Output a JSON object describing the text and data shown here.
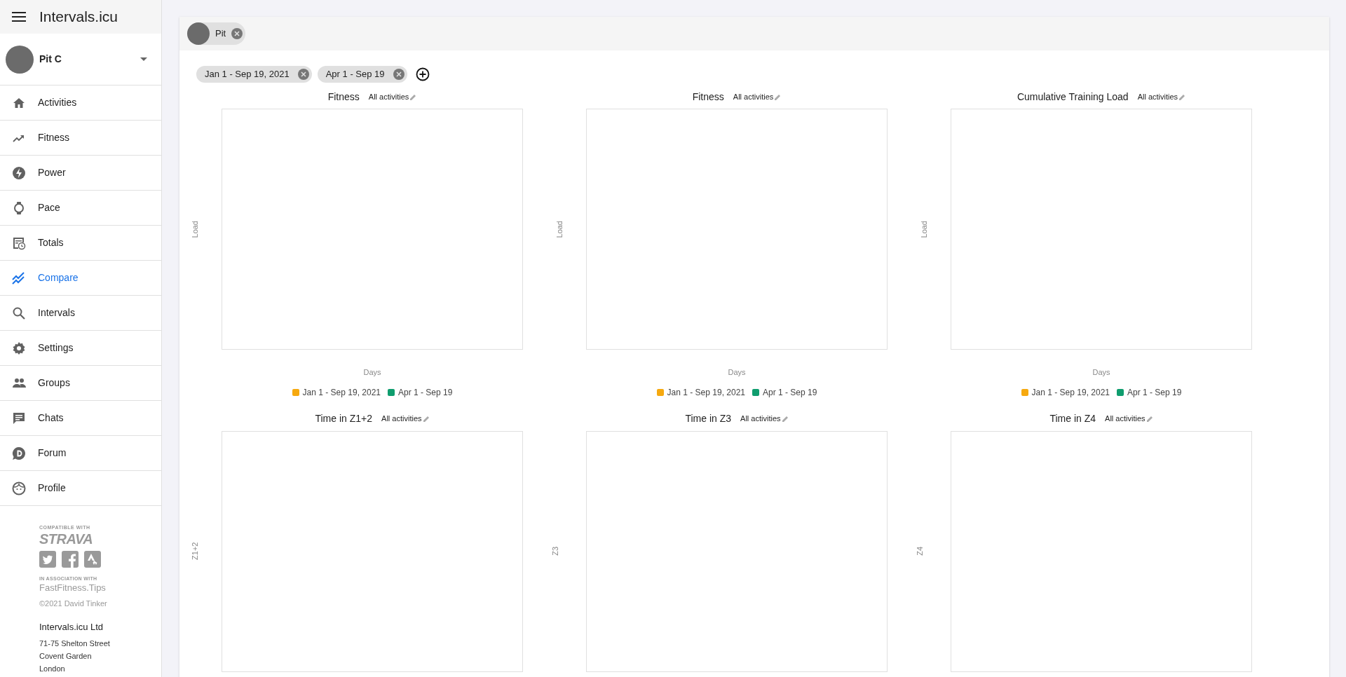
{
  "app": {
    "title": "Intervals.icu"
  },
  "user": {
    "name": "Pit C"
  },
  "nav": [
    {
      "label": "Activities",
      "selected": false
    },
    {
      "label": "Fitness",
      "selected": false
    },
    {
      "label": "Power",
      "selected": false
    },
    {
      "label": "Pace",
      "selected": false
    },
    {
      "label": "Totals",
      "selected": false
    },
    {
      "label": "Compare",
      "selected": true
    },
    {
      "label": "Intervals",
      "selected": false
    },
    {
      "label": "Settings",
      "selected": false
    },
    {
      "label": "Groups",
      "selected": false
    },
    {
      "label": "Chats",
      "selected": false
    },
    {
      "label": "Forum",
      "selected": false
    },
    {
      "label": "Profile",
      "selected": false
    }
  ],
  "footer": {
    "compatible_label": "COMPATIBLE WITH",
    "compatible_logo": "STRAVA",
    "association_label": "IN ASSOCIATION WITH",
    "association_name": "FastFitness.Tips",
    "copyright": "©2021 David Tinker",
    "company": "Intervals.icu Ltd",
    "address_lines": [
      "71-75 Shelton Street",
      "Covent Garden",
      "London"
    ]
  },
  "athletes": [
    {
      "label": "Pit"
    }
  ],
  "date_ranges": [
    {
      "label": "Jan 1 - Sep 19, 2021"
    },
    {
      "label": "Apr 1 - Sep 19"
    }
  ],
  "charts": [
    {
      "title": "Fitness",
      "filter": "All activities",
      "ylabel": "Load",
      "xlabel": "Days",
      "legend": [
        {
          "label": "Jan 1 - Sep 19, 2021",
          "color": "#f6a90f"
        },
        {
          "label": "Apr 1 - Sep 19",
          "color": "#0f9d6e"
        }
      ]
    },
    {
      "title": "Fitness",
      "filter": "All activities",
      "ylabel": "Load",
      "xlabel": "Days",
      "legend": [
        {
          "label": "Jan 1 - Sep 19, 2021",
          "color": "#f6a90f"
        },
        {
          "label": "Apr 1 - Sep 19",
          "color": "#0f9d6e"
        }
      ]
    },
    {
      "title": "Cumulative Training Load",
      "filter": "All activities",
      "ylabel": "Load",
      "xlabel": "Days",
      "legend": [
        {
          "label": "Jan 1 - Sep 19, 2021",
          "color": "#f6a90f"
        },
        {
          "label": "Apr 1 - Sep 19",
          "color": "#0f9d6e"
        }
      ]
    },
    {
      "title": "Time in Z1+2",
      "filter": "All activities",
      "ylabel": "Z1+2"
    },
    {
      "title": "Time in Z3",
      "filter": "All activities",
      "ylabel": "Z3"
    },
    {
      "title": "Time in Z4",
      "filter": "All activities",
      "ylabel": "Z4"
    }
  ]
}
